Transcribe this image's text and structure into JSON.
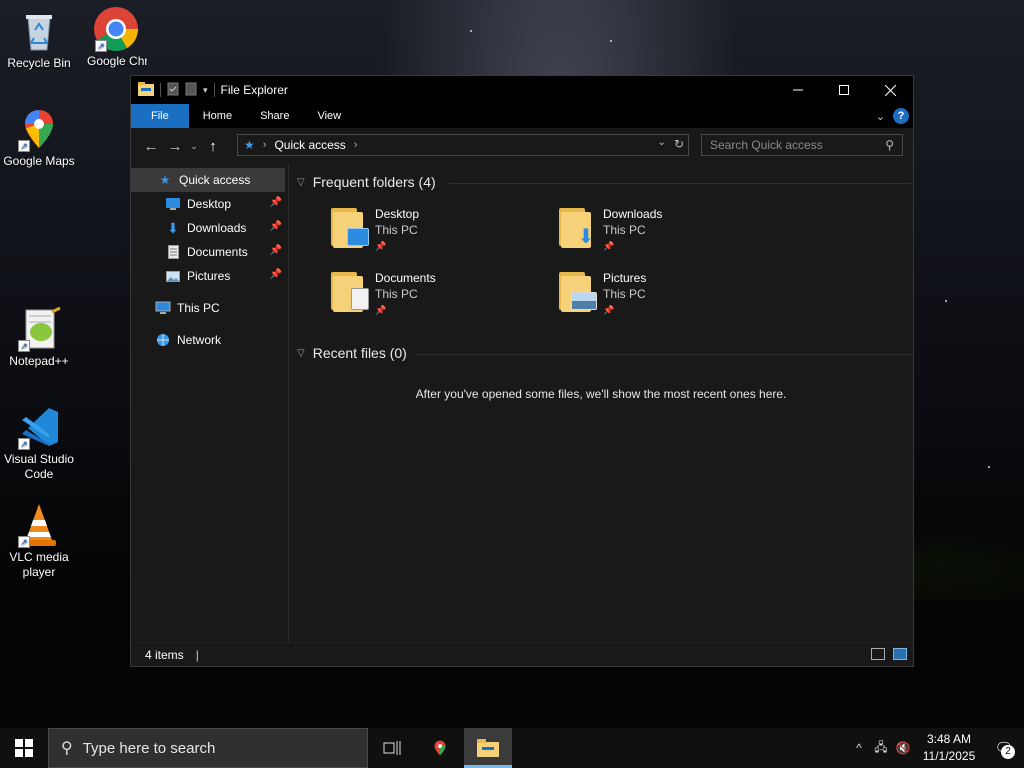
{
  "desktop": {
    "icons": [
      {
        "label": "Recycle Bin",
        "icon": "recycle-bin-icon"
      },
      {
        "label": "Google Chrome",
        "icon": "chrome-icon"
      },
      {
        "label": "Google Maps",
        "icon": "maps-icon"
      },
      {
        "label": "Notepad++",
        "icon": "notepadpp-icon"
      },
      {
        "label": "Visual Studio Code",
        "icon": "vscode-icon"
      },
      {
        "label": "VLC media player",
        "icon": "vlc-icon"
      }
    ]
  },
  "window": {
    "title": "File Explorer",
    "ribbon_tabs": [
      "File",
      "Home",
      "Share",
      "View"
    ],
    "help": "?",
    "address": {
      "path": "Quick access"
    },
    "search": {
      "placeholder": "Search Quick access"
    },
    "nav": {
      "quick_access": "Quick access",
      "pinned": [
        "Desktop",
        "Downloads",
        "Documents",
        "Pictures"
      ],
      "this_pc": "This PC",
      "network": "Network"
    },
    "frequent": {
      "header": "Frequent folders (4)",
      "folders": [
        {
          "name": "Desktop",
          "location": "This PC",
          "overlay": "desktop"
        },
        {
          "name": "Downloads",
          "location": "This PC",
          "overlay": "downloads"
        },
        {
          "name": "Documents",
          "location": "This PC",
          "overlay": "documents"
        },
        {
          "name": "Pictures",
          "location": "This PC",
          "overlay": "pictures"
        }
      ]
    },
    "recent": {
      "header": "Recent files (0)",
      "empty_message": "After you've opened some files, we'll show the most recent ones here."
    },
    "status": {
      "items": "4 items"
    }
  },
  "taskbar": {
    "search_placeholder": "Type here to search",
    "clock": {
      "time": "3:48 AM",
      "date": "11/1/2025"
    },
    "notification_count": "2"
  },
  "colors": {
    "accent": "#1a6fc2",
    "window_bg": "#191919",
    "folder": "#f5d27a"
  }
}
